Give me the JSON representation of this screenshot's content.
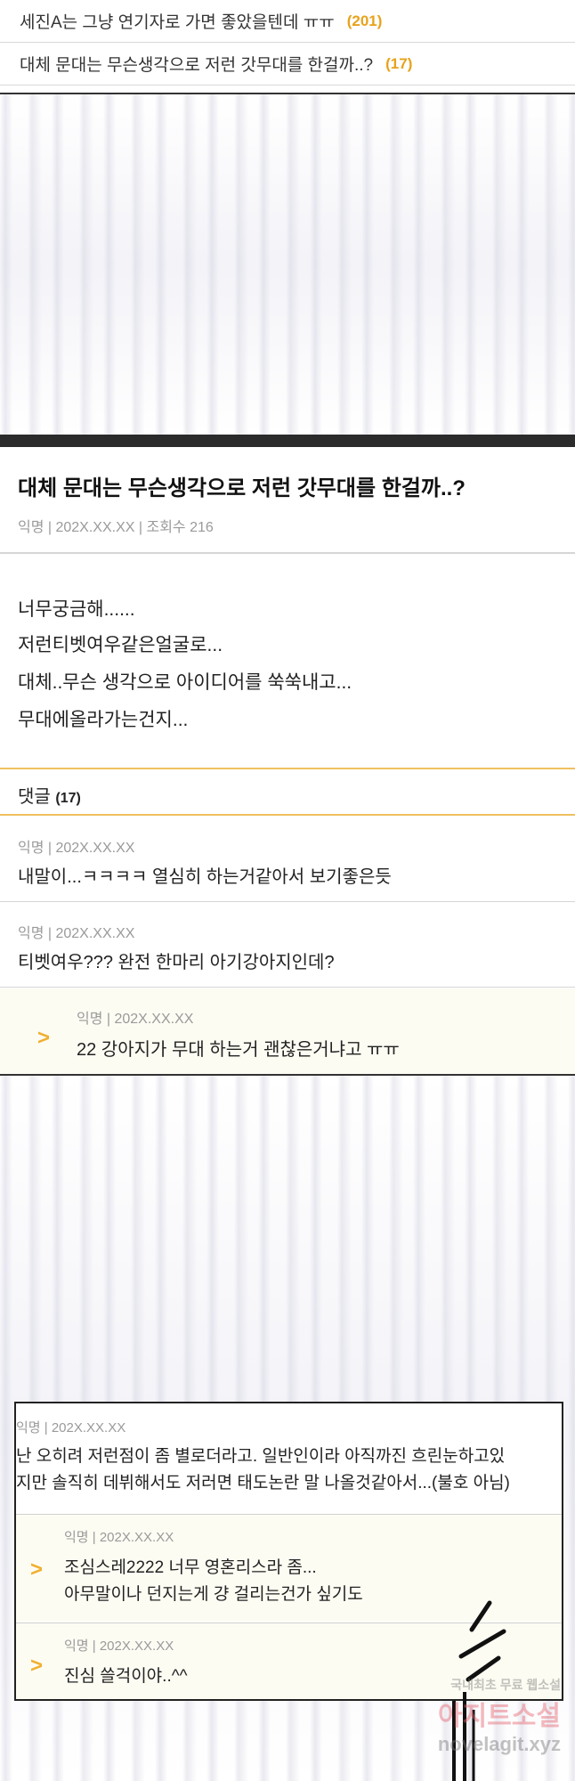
{
  "list": {
    "rows": [
      {
        "title": "세진A는 그냥 연기자로 가면 좋았을텐데 ㅠㅠ",
        "count": "(201)"
      },
      {
        "title": "대체 문대는 무슨생각으로 저런 갓무대를 한걸까..?",
        "count": "(17)"
      }
    ]
  },
  "post": {
    "title": "대체 문대는 무슨생각으로 저런 갓무대를 한걸까..?",
    "meta": "익명 | 202X.XX.XX | 조회수 216",
    "body": [
      "너무궁금해......",
      "저런티벳여우같은얼굴로...",
      "대체..무슨 생각으로 아이디어를 쑥쑥내고...",
      "무대에올라가는건지..."
    ]
  },
  "comments": {
    "label": "댓글",
    "count": "(17)",
    "items": [
      {
        "meta": "익명 | 202X.XX.XX",
        "text": "내말이...ㅋㅋㅋㅋ 열심히 하는거같아서 보기좋은듯"
      },
      {
        "meta": "익명 | 202X.XX.XX",
        "text": "티벳여우??? 완전 한마리 아기강아지인데?"
      }
    ],
    "reply": {
      "meta": "익명 | 202X.XX.XX",
      "text": "22 강아지가 무대 하는거 괜찮은거냐고 ㅠㅠ"
    }
  },
  "second_panel": {
    "comment": {
      "meta": "익명 | 202X.XX.XX",
      "lines": [
        "난 오히려 저런점이 좀 별로더라고. 일반인이라 아직까진 흐린눈하고있",
        "지만 솔직히 데뷔해서도 저러면 태도논란 말 나올것같아서...(불호 아님)"
      ]
    },
    "replies": [
      {
        "meta": "익명 | 202X.XX.XX",
        "lines": [
          "조심스레2222 너무 영혼리스라 좀...",
          "아무말이나 던지는게 걍 걸리는건가 싶기도"
        ]
      },
      {
        "meta": "익명 | 202X.XX.XX",
        "lines": [
          "진심 쓸걱이야..^^"
        ]
      }
    ]
  },
  "arrow_glyph": ">",
  "watermark": {
    "line1": "국내최초 무료 웹소설",
    "line2": "아지트소설",
    "line3": "novelagit.xyz"
  },
  "colors": {
    "accent": "#e8a21b",
    "dark_bar": "#2b2b2b",
    "reply_bg": "#fdfcf3"
  }
}
